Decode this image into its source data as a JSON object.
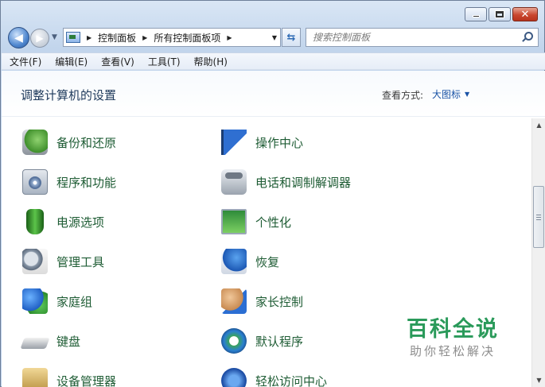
{
  "nav": {
    "breadcrumb": [
      "控制面板",
      "所有控制面板项"
    ],
    "search_placeholder": "搜索控制面板"
  },
  "menubar": {
    "items": [
      "文件(F)",
      "编辑(E)",
      "查看(V)",
      "工具(T)",
      "帮助(H)"
    ]
  },
  "header": {
    "title": "调整计算机的设置",
    "viewby_label": "查看方式:",
    "viewby_value": "大图标"
  },
  "items": [
    {
      "label": "备份和还原",
      "icon": "backup-restore-icon"
    },
    {
      "label": "操作中心",
      "icon": "action-center-flag-icon"
    },
    {
      "label": "程序和功能",
      "icon": "programs-features-icon"
    },
    {
      "label": "电话和调制解调器",
      "icon": "phone-modem-icon"
    },
    {
      "label": "电源选项",
      "icon": "power-options-icon"
    },
    {
      "label": "个性化",
      "icon": "personalization-icon"
    },
    {
      "label": "管理工具",
      "icon": "admin-tools-icon"
    },
    {
      "label": "恢复",
      "icon": "recovery-icon"
    },
    {
      "label": "家庭组",
      "icon": "homegroup-icon"
    },
    {
      "label": "家长控制",
      "icon": "parental-controls-icon"
    },
    {
      "label": "键盘",
      "icon": "keyboard-icon"
    },
    {
      "label": "默认程序",
      "icon": "default-programs-icon"
    },
    {
      "label": "设备管理器",
      "icon": "device-manager-icon"
    },
    {
      "label": "轻松访问中心",
      "icon": "ease-of-access-icon"
    }
  ],
  "watermark": {
    "main": "百科全说",
    "sub": "助你轻松解决"
  }
}
